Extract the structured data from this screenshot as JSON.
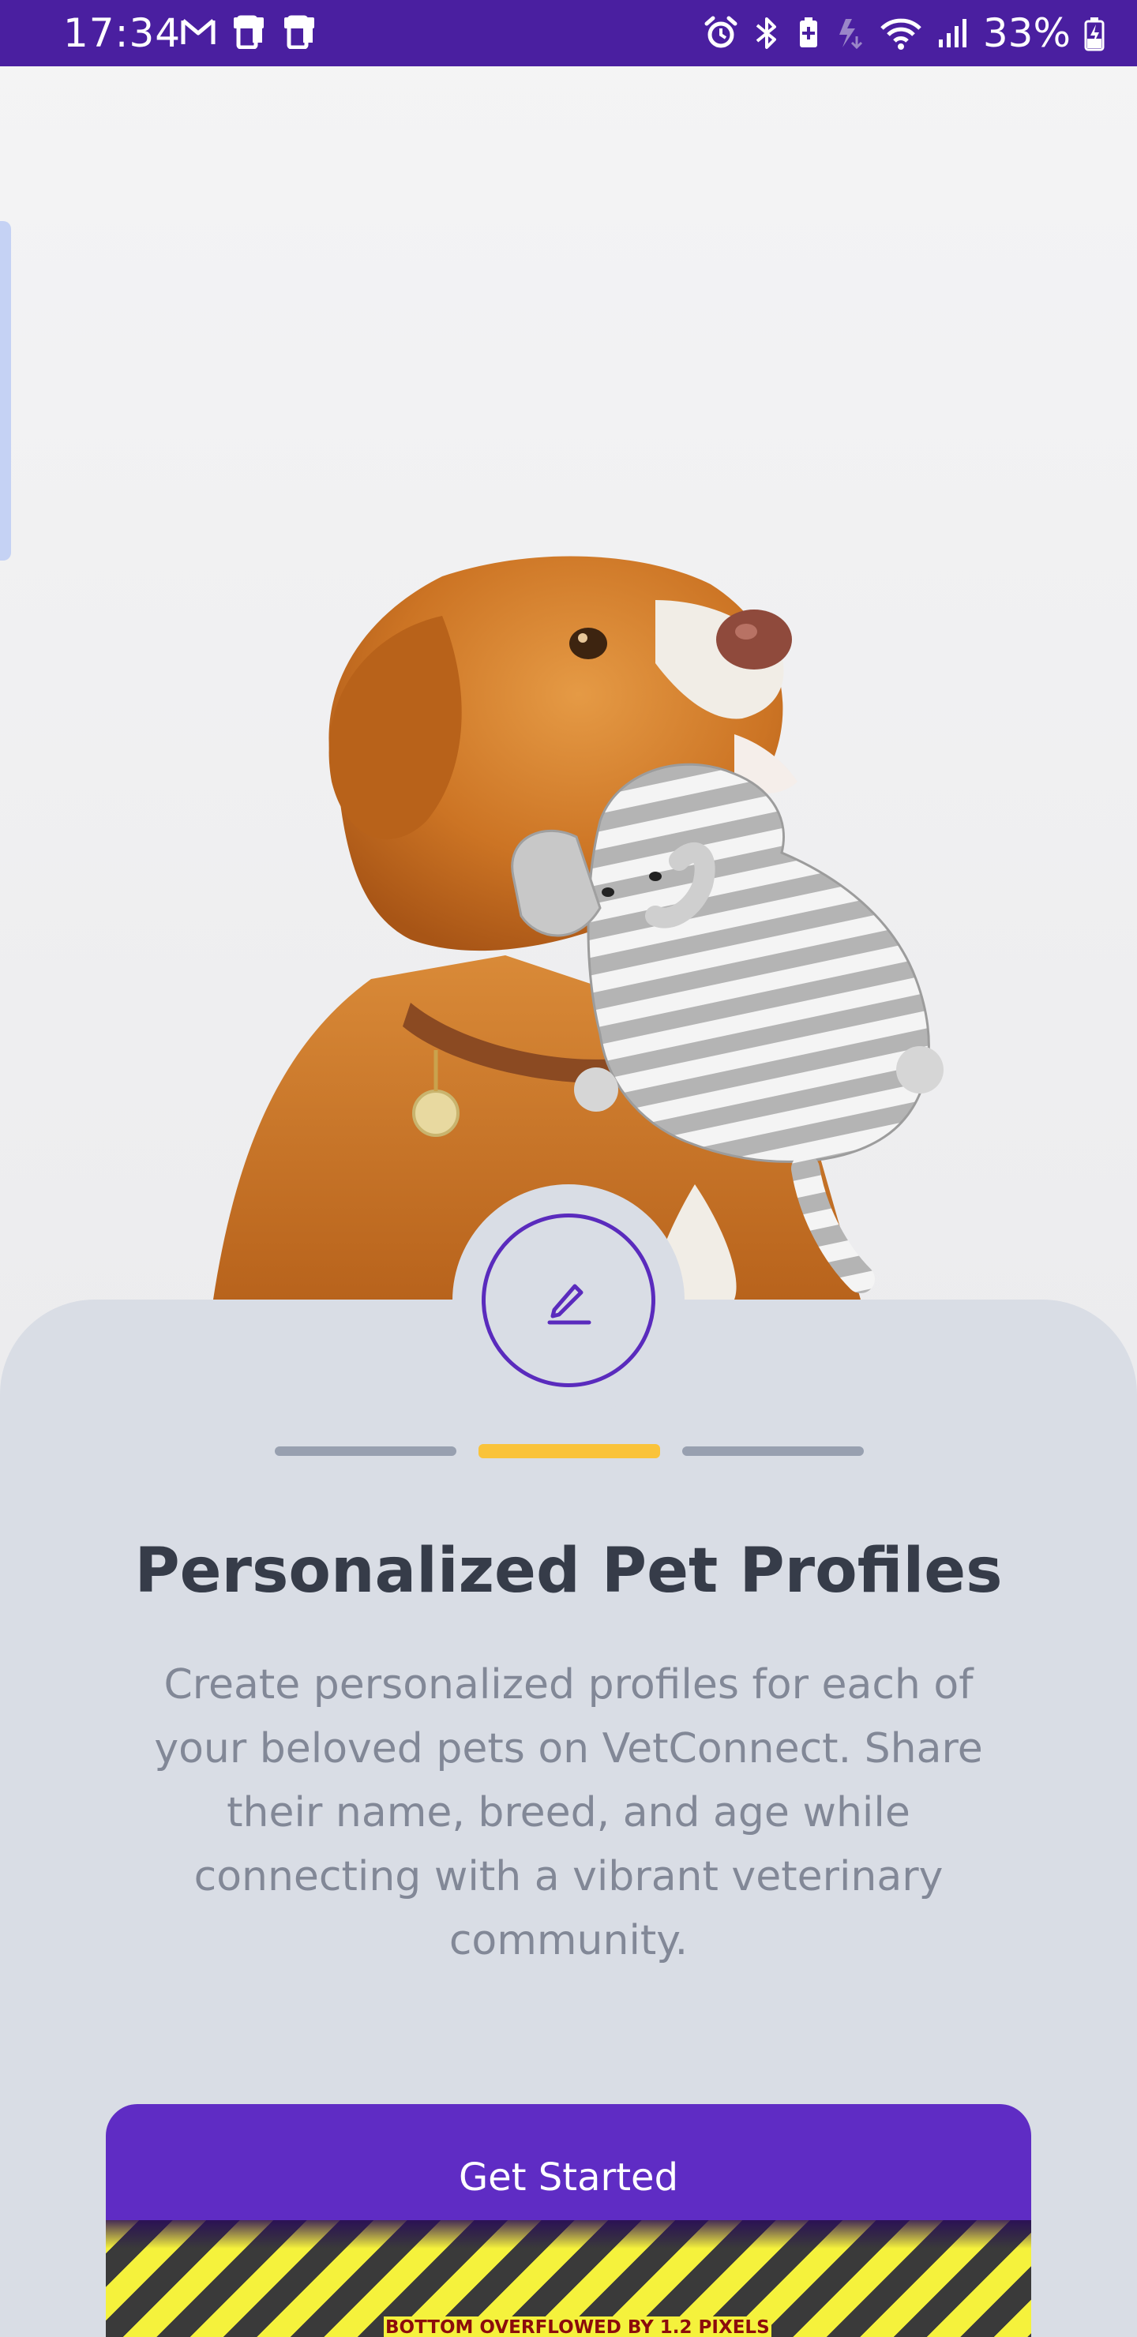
{
  "status_bar": {
    "time": "17:34",
    "battery": "33%",
    "left_icons": [
      "gmail-icon",
      "phone-link-icon",
      "phone-link-icon"
    ],
    "right_icons": [
      "alarm-icon",
      "bluetooth-icon",
      "battery-saver-icon",
      "data-icon",
      "wifi-icon",
      "signal-icon",
      "battery-charging-icon"
    ],
    "background": "#4a1fa0"
  },
  "onboarding": {
    "badge_icon": "edit-icon",
    "page_indicator": {
      "total": 3,
      "current": 2
    },
    "title": "Personalized Pet Profiles",
    "description": "Create personalized profiles for each of your beloved pets on VetConnect. Share their name, breed, and age while connecting with a vibrant veterinary community.",
    "cta_label": "Get Started",
    "overflow_warning": "BOTTOM OVERFLOWED BY 1.2 PIXELS"
  },
  "colors": {
    "accent": "#5f2cc4",
    "indicator_active": "#fac33a",
    "indicator_inactive": "#98a0b0",
    "sheet": "#d9dde5"
  }
}
